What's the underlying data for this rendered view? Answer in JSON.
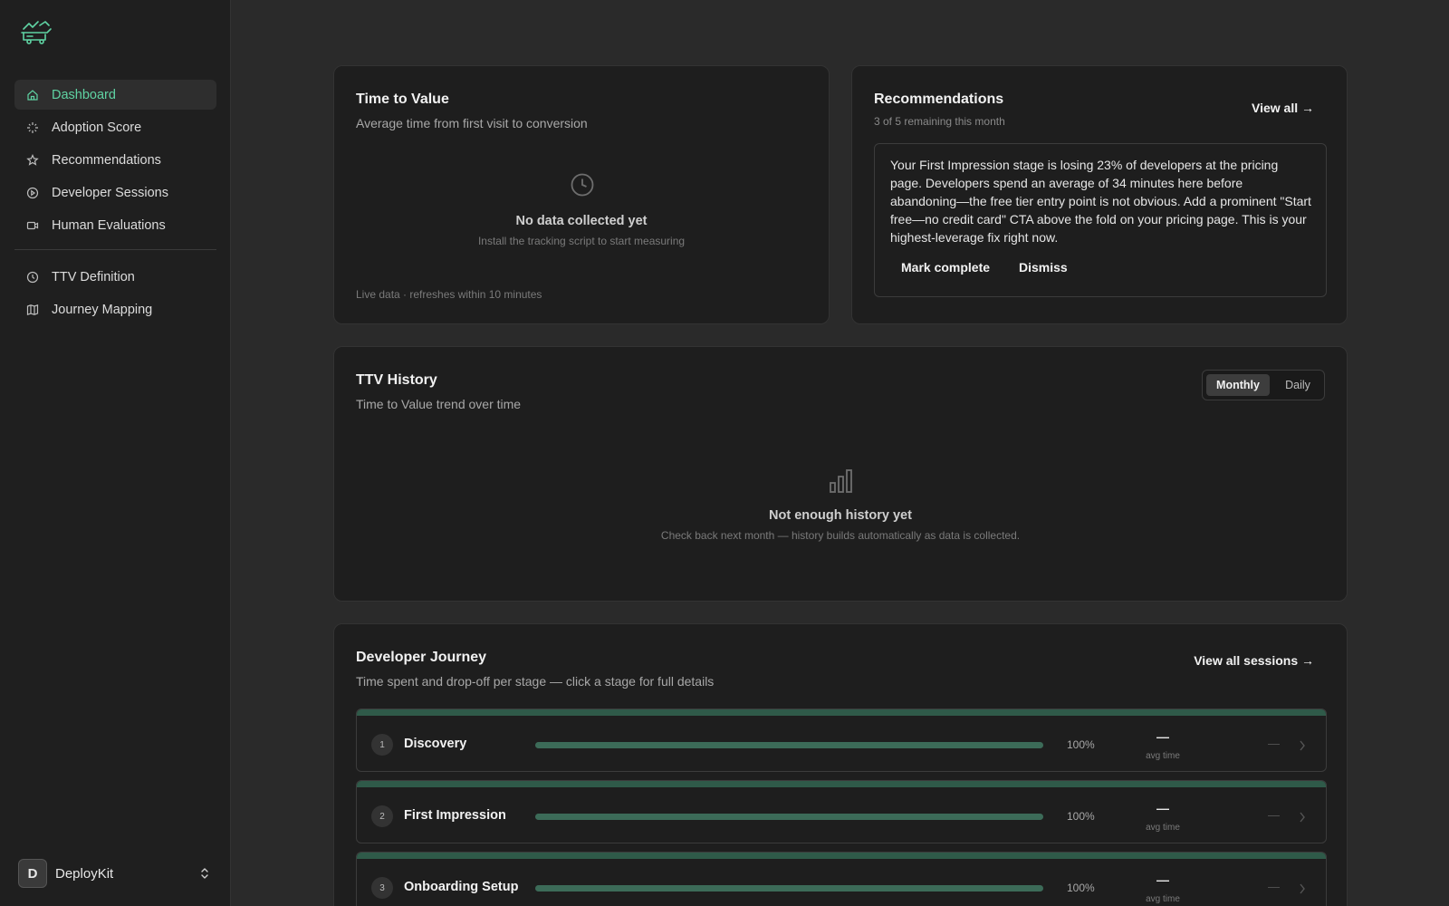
{
  "sidebar": {
    "items": [
      {
        "label": "Dashboard",
        "icon": "home-icon",
        "active": true
      },
      {
        "label": "Adoption Score",
        "icon": "sparkle-icon"
      },
      {
        "label": "Recommendations",
        "icon": "star-icon"
      },
      {
        "label": "Developer Sessions",
        "icon": "play-circle-icon"
      },
      {
        "label": "Human Evaluations",
        "icon": "video-icon"
      }
    ],
    "items2": [
      {
        "label": "TTV Definition",
        "icon": "clock-icon"
      },
      {
        "label": "Journey Mapping",
        "icon": "map-icon"
      }
    ],
    "workspace": {
      "initial": "D",
      "name": "DeployKit"
    }
  },
  "ttv": {
    "title": "Time to Value",
    "subtitle": "Average time from first visit to conversion",
    "empty_title": "No data collected yet",
    "empty_sub": "Install the tracking script to start measuring",
    "footnote": "Live data · refreshes within 10 minutes"
  },
  "recommendations": {
    "title": "Recommendations",
    "remaining": "3 of 5 remaining this month",
    "view_all": "View all →",
    "text": "Your First Impression stage is losing 23% of developers at the pricing page. Developers spend an average of 34 minutes here before abandoning—the free tier entry point is not obvious. Add a prominent \"Start free—no credit card\" CTA above the fold on your pricing page. This is your highest-leverage fix right now.",
    "mark_complete": "Mark complete",
    "dismiss": "Dismiss"
  },
  "history": {
    "title": "TTV History",
    "subtitle": "Time to Value trend over time",
    "toggle": {
      "monthly": "Monthly",
      "daily": "Daily",
      "selected": "Monthly"
    },
    "empty_title": "Not enough history yet",
    "empty_sub": "Check back next month — history builds automatically as data is collected."
  },
  "journey": {
    "title": "Developer Journey",
    "subtitle": "Time spent and drop-off per stage — click a stage for full details",
    "view_all": "View all sessions →",
    "stages": [
      {
        "num": "1",
        "name": "Discovery",
        "pct": "100%",
        "fill": 1.0,
        "avg": "—",
        "avg_label": "avg time",
        "dropoff": "—"
      },
      {
        "num": "2",
        "name": "First Impression",
        "pct": "100%",
        "fill": 1.0,
        "avg": "—",
        "avg_label": "avg time",
        "dropoff": "—"
      },
      {
        "num": "3",
        "name": "Onboarding Setup",
        "pct": "100%",
        "fill": 1.0,
        "avg": "—",
        "avg_label": "avg time",
        "dropoff": "—"
      }
    ]
  },
  "colors": {
    "accent": "#5fd3a3",
    "bar": "#3c6b58",
    "stage_top": "#2f5a49"
  }
}
